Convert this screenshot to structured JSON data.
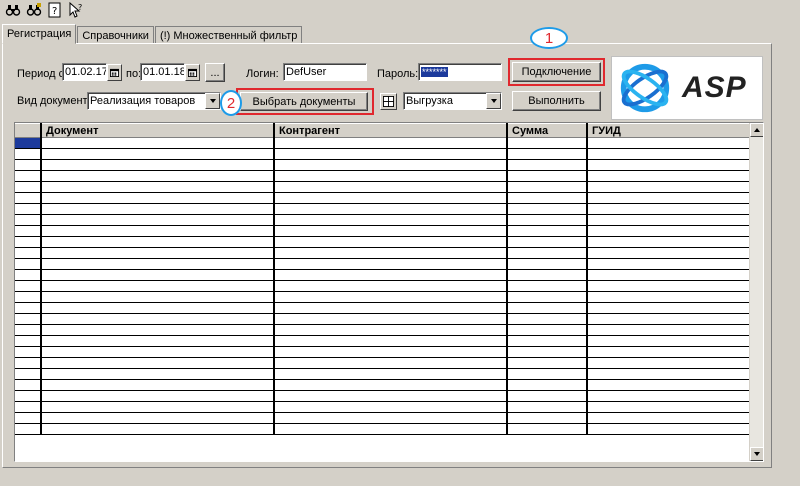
{
  "toolbar": {
    "icons": [
      "binoculars-icon",
      "binoculars-lock-icon",
      "help-icon",
      "pointer-help-icon"
    ]
  },
  "tabs": [
    {
      "label": "Регистрация",
      "active": true
    },
    {
      "label": "Справочники",
      "active": false
    },
    {
      "label": "(!) Множественный фильтр",
      "active": false
    }
  ],
  "form": {
    "period_from_label": "Период с:",
    "period_from_value": "01.02.17",
    "period_to_label": "по:",
    "period_to_value": "01.01.18",
    "period_more_button": "...",
    "login_label": "Логин:",
    "login_value": "DefUser",
    "password_label": "Пароль:",
    "password_value": "*******",
    "connect_button": "Подключение",
    "doc_type_label": "Вид документа:",
    "doc_type_value": "Реализация товаров",
    "select_docs_button": "Выбрать документы",
    "mode_value": "Выгрузка",
    "execute_button": "Выполнить"
  },
  "annotations": {
    "badge1": "1",
    "badge2": "2",
    "accent_red": "#e0282e",
    "accent_blue": "#1e9be8"
  },
  "logo": {
    "text": "ASP"
  },
  "table": {
    "columns": [
      "",
      "Документ",
      "Контрагент",
      "Сумма",
      "ГУИД"
    ],
    "row_count": 27
  }
}
